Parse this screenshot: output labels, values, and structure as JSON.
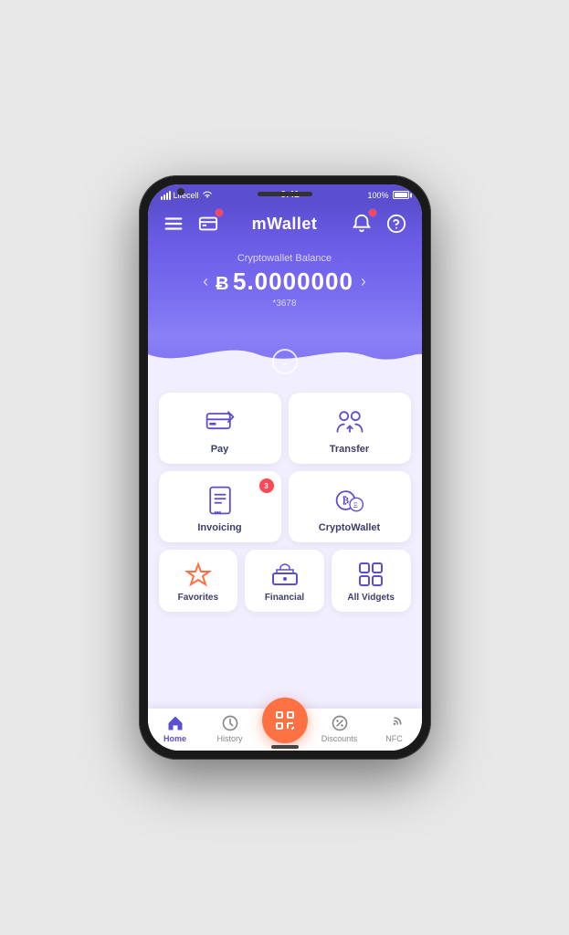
{
  "status_bar": {
    "carrier": "Lifecell",
    "wifi": true,
    "time": "9:41",
    "battery": "100%"
  },
  "header": {
    "title": "mWallet",
    "menu_label": "Menu",
    "card_label": "Card",
    "bell_label": "Notifications",
    "help_label": "Help"
  },
  "balance": {
    "label": "Cryptowallet Balance",
    "currency_symbol": "Ƀ",
    "amount": "5.0000000",
    "account": "*3678",
    "prev_label": "Previous",
    "next_label": "Next",
    "expand_label": "Expand"
  },
  "grid": {
    "row1": [
      {
        "id": "pay",
        "label": "Pay"
      },
      {
        "id": "transfer",
        "label": "Transfer"
      }
    ],
    "row2": [
      {
        "id": "invoicing",
        "label": "Invoicing",
        "badge": "3"
      },
      {
        "id": "cryptowallet",
        "label": "CryptoWallet"
      }
    ],
    "row3": [
      {
        "id": "favorites",
        "label": "Favorites"
      },
      {
        "id": "financial",
        "label": "Financial"
      },
      {
        "id": "allwidgets",
        "label": "All Vidgets"
      }
    ]
  },
  "tab_bar": {
    "items": [
      {
        "id": "home",
        "label": "Home",
        "active": true
      },
      {
        "id": "history",
        "label": "History",
        "active": false
      },
      {
        "id": "scan",
        "label": "Scan",
        "active": false
      },
      {
        "id": "discounts",
        "label": "Discounts",
        "active": false
      },
      {
        "id": "nfc",
        "label": "NFC",
        "active": false
      }
    ]
  },
  "colors": {
    "primary": "#5b4fcf",
    "accent_orange": "#ff7043",
    "badge_red": "#ff4757"
  }
}
